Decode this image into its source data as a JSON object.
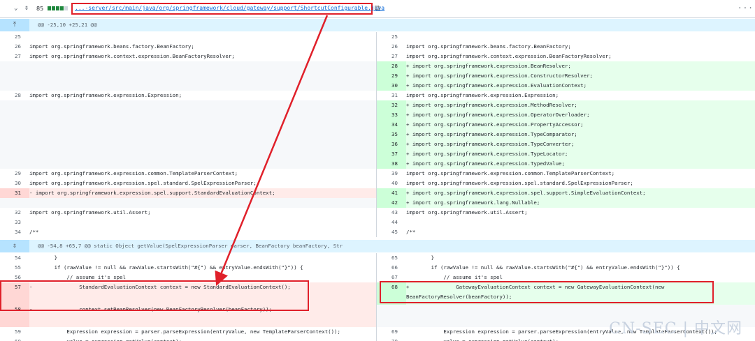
{
  "file": {
    "changes": "85",
    "path": "...-server/src/main/java/org/springframework/cloud/gateway/support/ShortcutConfigurable.java",
    "chev_icon": "chevron-down-icon",
    "expand_icon": "unfold-icon",
    "copy_icon": "copy-icon",
    "more_icon": "kebab-icon",
    "more_glyph": "···"
  },
  "hunks": [
    {
      "text": "@@ -25,10 +25,21 @@"
    },
    {
      "text": "@@ -54,8 +65,7 @@ static Object getValue(SpelExpressionParser parser, BeanFactory beanFactory, Str"
    }
  ],
  "left_lines": [
    {
      "n": "25",
      "t": "",
      "k": "ctx"
    },
    {
      "n": "26",
      "t": "import org.springframework.beans.factory.BeanFactory;",
      "k": "ctx"
    },
    {
      "n": "27",
      "t": "import org.springframework.context.expression.BeanFactoryResolver;",
      "k": "ctx"
    },
    {
      "n": "",
      "t": "",
      "k": "blank"
    },
    {
      "n": "",
      "t": "",
      "k": "blank"
    },
    {
      "n": "",
      "t": "",
      "k": "blank"
    },
    {
      "n": "28",
      "t": "import org.springframework.expression.Expression;",
      "k": "ctx"
    },
    {
      "n": "",
      "t": "",
      "k": "blank"
    },
    {
      "n": "",
      "t": "",
      "k": "blank"
    },
    {
      "n": "",
      "t": "",
      "k": "blank"
    },
    {
      "n": "",
      "t": "",
      "k": "blank"
    },
    {
      "n": "",
      "t": "",
      "k": "blank"
    },
    {
      "n": "",
      "t": "",
      "k": "blank"
    },
    {
      "n": "",
      "t": "",
      "k": "blank"
    },
    {
      "n": "29",
      "t": "import org.springframework.expression.common.TemplateParserContext;",
      "k": "ctx"
    },
    {
      "n": "30",
      "t": "import org.springframework.expression.spel.standard.SpelExpressionParser;",
      "k": "ctx"
    },
    {
      "n": "31",
      "t": "- import org.springframework.expression.spel.support.StandardEvaluationContext;",
      "k": "del"
    },
    {
      "n": "",
      "t": "",
      "k": "blank"
    },
    {
      "n": "32",
      "t": "import org.springframework.util.Assert;",
      "k": "ctx"
    },
    {
      "n": "33",
      "t": "",
      "k": "ctx"
    },
    {
      "n": "34",
      "t": "/**",
      "k": "ctx"
    }
  ],
  "right_lines": [
    {
      "n": "25",
      "t": "",
      "k": "ctx"
    },
    {
      "n": "26",
      "t": "import org.springframework.beans.factory.BeanFactory;",
      "k": "ctx"
    },
    {
      "n": "27",
      "t": "import org.springframework.context.expression.BeanFactoryResolver;",
      "k": "ctx"
    },
    {
      "n": "28",
      "t": "+ import org.springframework.expression.BeanResolver;",
      "k": "add"
    },
    {
      "n": "29",
      "t": "+ import org.springframework.expression.ConstructorResolver;",
      "k": "add"
    },
    {
      "n": "30",
      "t": "+ import org.springframework.expression.EvaluationContext;",
      "k": "add"
    },
    {
      "n": "31",
      "t": "import org.springframework.expression.Expression;",
      "k": "ctx"
    },
    {
      "n": "32",
      "t": "+ import org.springframework.expression.MethodResolver;",
      "k": "add"
    },
    {
      "n": "33",
      "t": "+ import org.springframework.expression.OperatorOverloader;",
      "k": "add"
    },
    {
      "n": "34",
      "t": "+ import org.springframework.expression.PropertyAccessor;",
      "k": "add"
    },
    {
      "n": "35",
      "t": "+ import org.springframework.expression.TypeComparator;",
      "k": "add"
    },
    {
      "n": "36",
      "t": "+ import org.springframework.expression.TypeConverter;",
      "k": "add"
    },
    {
      "n": "37",
      "t": "+ import org.springframework.expression.TypeLocator;",
      "k": "add"
    },
    {
      "n": "38",
      "t": "+ import org.springframework.expression.TypedValue;",
      "k": "add"
    },
    {
      "n": "39",
      "t": "import org.springframework.expression.common.TemplateParserContext;",
      "k": "ctx"
    },
    {
      "n": "40",
      "t": "import org.springframework.expression.spel.standard.SpelExpressionParser;",
      "k": "ctx"
    },
    {
      "n": "41",
      "t": "+ import org.springframework.expression.spel.support.SimpleEvaluationContext;",
      "k": "add"
    },
    {
      "n": "42",
      "t": "+ import org.springframework.lang.Nullable;",
      "k": "add"
    },
    {
      "n": "43",
      "t": "import org.springframework.util.Assert;",
      "k": "ctx"
    },
    {
      "n": "44",
      "t": "",
      "k": "ctx"
    },
    {
      "n": "45",
      "t": "/**",
      "k": "ctx"
    }
  ],
  "left_lines2": [
    {
      "n": "54",
      "t": "        }",
      "k": "ctx"
    },
    {
      "n": "55",
      "t": "        if (rawValue != null && rawValue.startsWith(\"#{\") && entryValue.endsWith(\"}\")) {",
      "k": "ctx"
    },
    {
      "n": "56",
      "t": "            // assume it's spel",
      "k": "ctx"
    },
    {
      "n": "57",
      "t": "-               StandardEvaluationContext context = new StandardEvaluationContext();",
      "k": "del",
      "h": 2
    },
    {
      "n": "58",
      "t": "-               context.setBeanResolver(new BeanFactoryResolver(beanFactory));",
      "k": "del",
      "h": 2
    },
    {
      "n": "59",
      "t": "            Expression expression = parser.parseExpression(entryValue, new TemplateParserContext());",
      "k": "ctx"
    },
    {
      "n": "60",
      "t": "            value = expression.getValue(context);",
      "k": "ctx"
    },
    {
      "n": "61",
      "t": "        }",
      "k": "ctx"
    }
  ],
  "right_lines2": [
    {
      "n": "65",
      "t": "        }",
      "k": "ctx"
    },
    {
      "n": "66",
      "t": "        if (rawValue != null && rawValue.startsWith(\"#{\") && entryValue.endsWith(\"}\")) {",
      "k": "ctx"
    },
    {
      "n": "67",
      "t": "            // assume it's spel",
      "k": "ctx"
    },
    {
      "n": "68",
      "t": "+               GatewayEvaluationContext context = new GatewayEvaluationContext(new\nBeanFactoryResolver(beanFactory));",
      "k": "add",
      "h": 2
    },
    {
      "n": "",
      "t": "",
      "k": "blank",
      "h": 2
    },
    {
      "n": "69",
      "t": "            Expression expression = parser.parseExpression(entryValue, new TemplateParserContext());",
      "k": "ctx"
    },
    {
      "n": "70",
      "t": "            value = expression.getValue(context);",
      "k": "ctx"
    },
    {
      "n": "71",
      "t": "        }",
      "k": "ctx"
    }
  ],
  "watermark": "CN-SEC | 中文网",
  "colors": {
    "del_bg": "#ffebe9",
    "add_bg": "#e6ffec",
    "hunk_bg": "#ddf4ff",
    "highlight": "#e0202a",
    "link": "#0969da"
  }
}
